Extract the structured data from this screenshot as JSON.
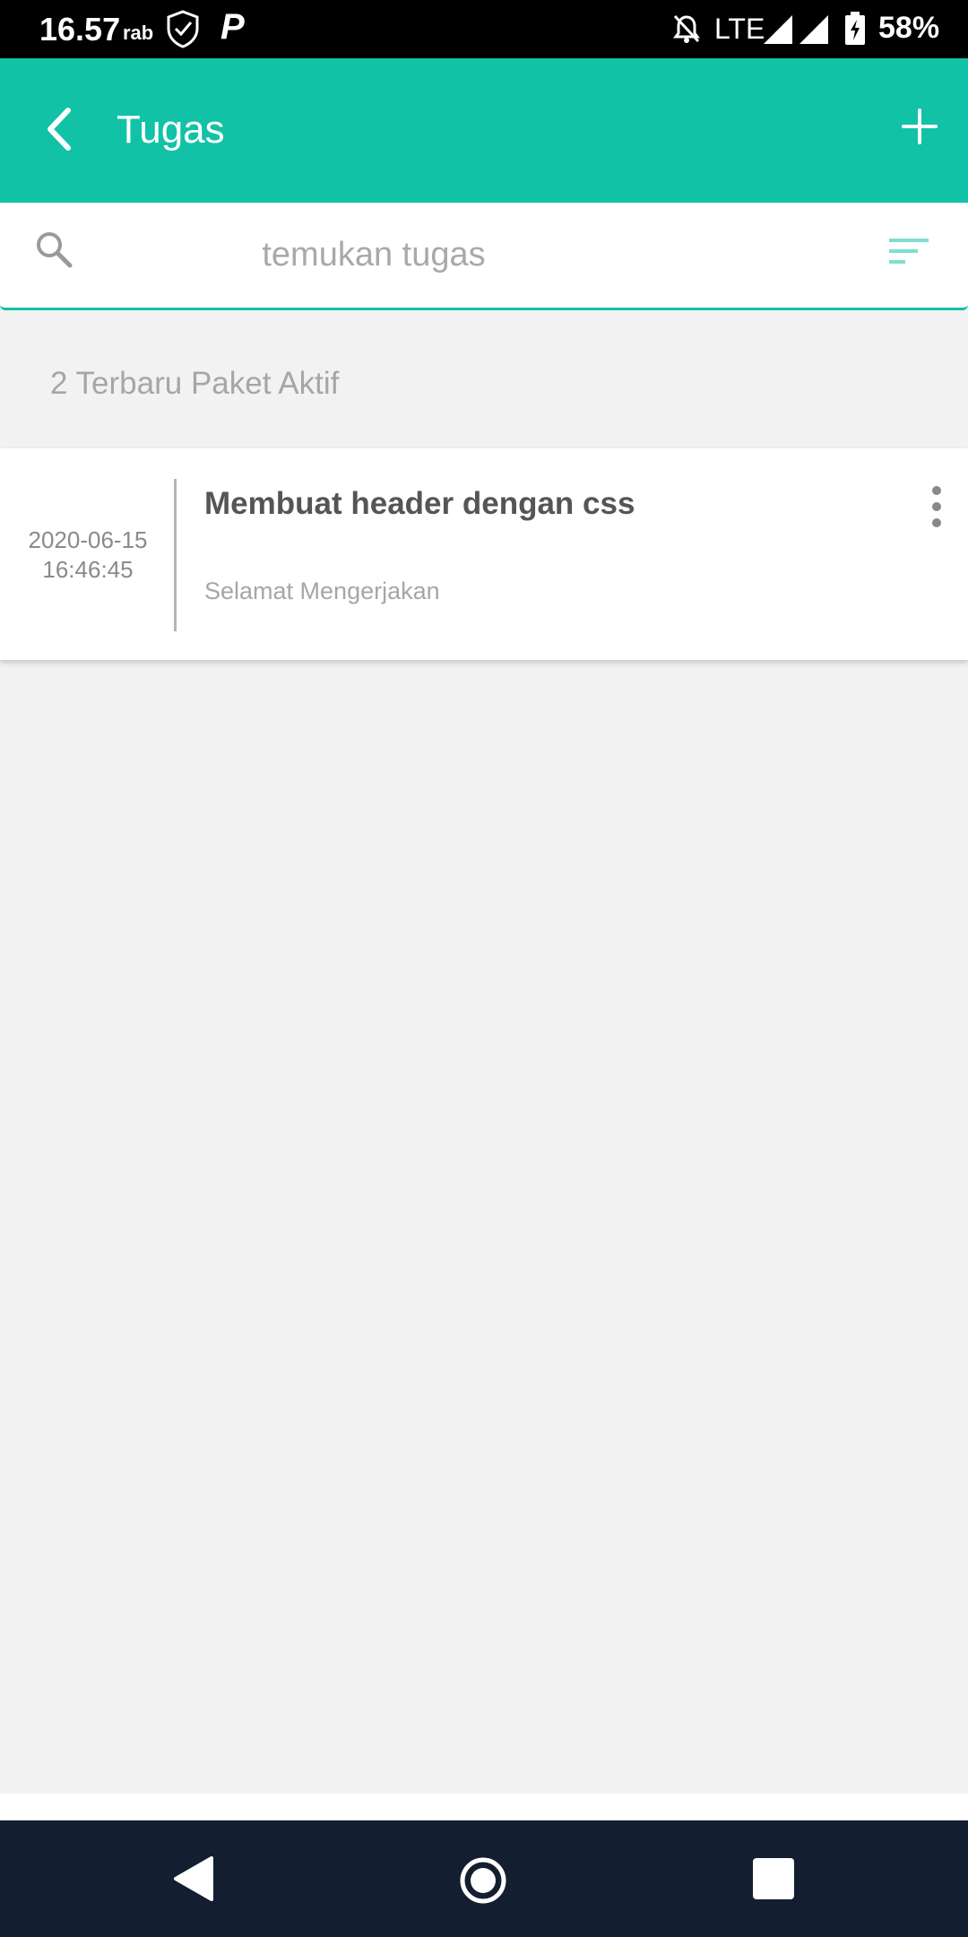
{
  "status_bar": {
    "time": "16.57",
    "day": "rab",
    "network": "LTE",
    "battery": "58%"
  },
  "app_bar": {
    "title": "Tugas",
    "color": "#11c2a6"
  },
  "search": {
    "placeholder": "temukan tugas"
  },
  "section": {
    "header": "2 Terbaru Paket Aktif"
  },
  "tasks": [
    {
      "date": "2020-06-15",
      "time": "16:46:45",
      "title": "Membuat header dengan css",
      "subtitle": "Selamat Mengerjakan"
    }
  ],
  "icons": {
    "back": "chevron-left-icon",
    "add": "plus-icon",
    "search": "search-icon",
    "filter": "filter-sort-icon",
    "more": "more-vertical-icon"
  }
}
